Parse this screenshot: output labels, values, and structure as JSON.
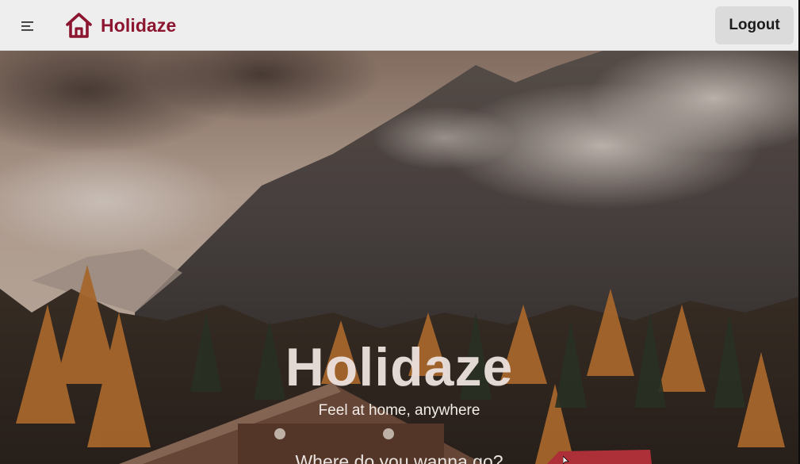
{
  "header": {
    "brand": "Holidaze",
    "menu_icon": "menu-icon",
    "brand_icon": "house-icon",
    "logout_label": "Logout"
  },
  "hero": {
    "title": "Holidaze",
    "subtitle": "Feel at home, anywhere",
    "question": "Where do you wanna go?"
  },
  "colors": {
    "brand": "#8c1530",
    "header_bg": "#efeeee",
    "button_bg": "#dcdbdb"
  }
}
